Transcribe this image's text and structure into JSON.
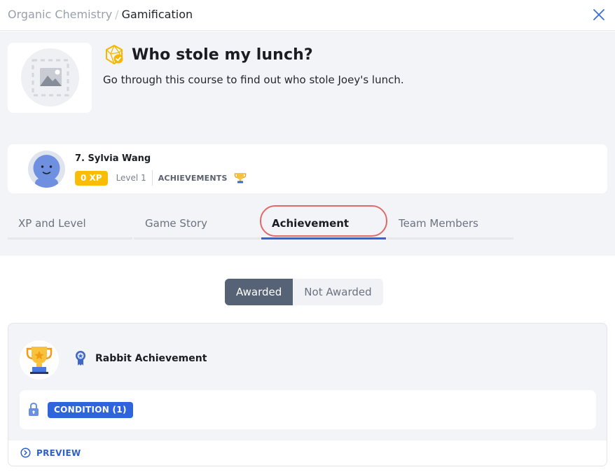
{
  "breadcrumb": {
    "parent": "Organic Chemistry",
    "separator": "/",
    "current": "Gamification"
  },
  "header": {
    "close_icon": "close-icon"
  },
  "course": {
    "title": "Who stole my lunch?",
    "description": "Go through this course to find out who stole Joey's lunch.",
    "title_icon": "gamification-badge-icon",
    "cover_icon": "image-placeholder-icon"
  },
  "user": {
    "name": "7. Sylvia Wang",
    "xp": "0 XP",
    "level": "Level 1",
    "achievements_label": "ACHIEVEMENTS",
    "achievements_icon": "trophy-icon"
  },
  "tabs": [
    {
      "label": "XP and Level",
      "active": false
    },
    {
      "label": "Game Story",
      "active": false
    },
    {
      "label": "Achievement",
      "active": true
    },
    {
      "label": "Team Members",
      "active": false
    }
  ],
  "filter": {
    "options": [
      "Awarded",
      "Not Awarded"
    ],
    "selected": "Awarded"
  },
  "achievements": [
    {
      "name": "Rabbit Achievement",
      "condition_label": "CONDITION (1)",
      "preview_label": "PREVIEW"
    }
  ],
  "colors": {
    "accent": "#2f64dc",
    "xp_badge": "#fbbc05",
    "segment_active": "#566275",
    "highlight": "#e06a6a"
  }
}
